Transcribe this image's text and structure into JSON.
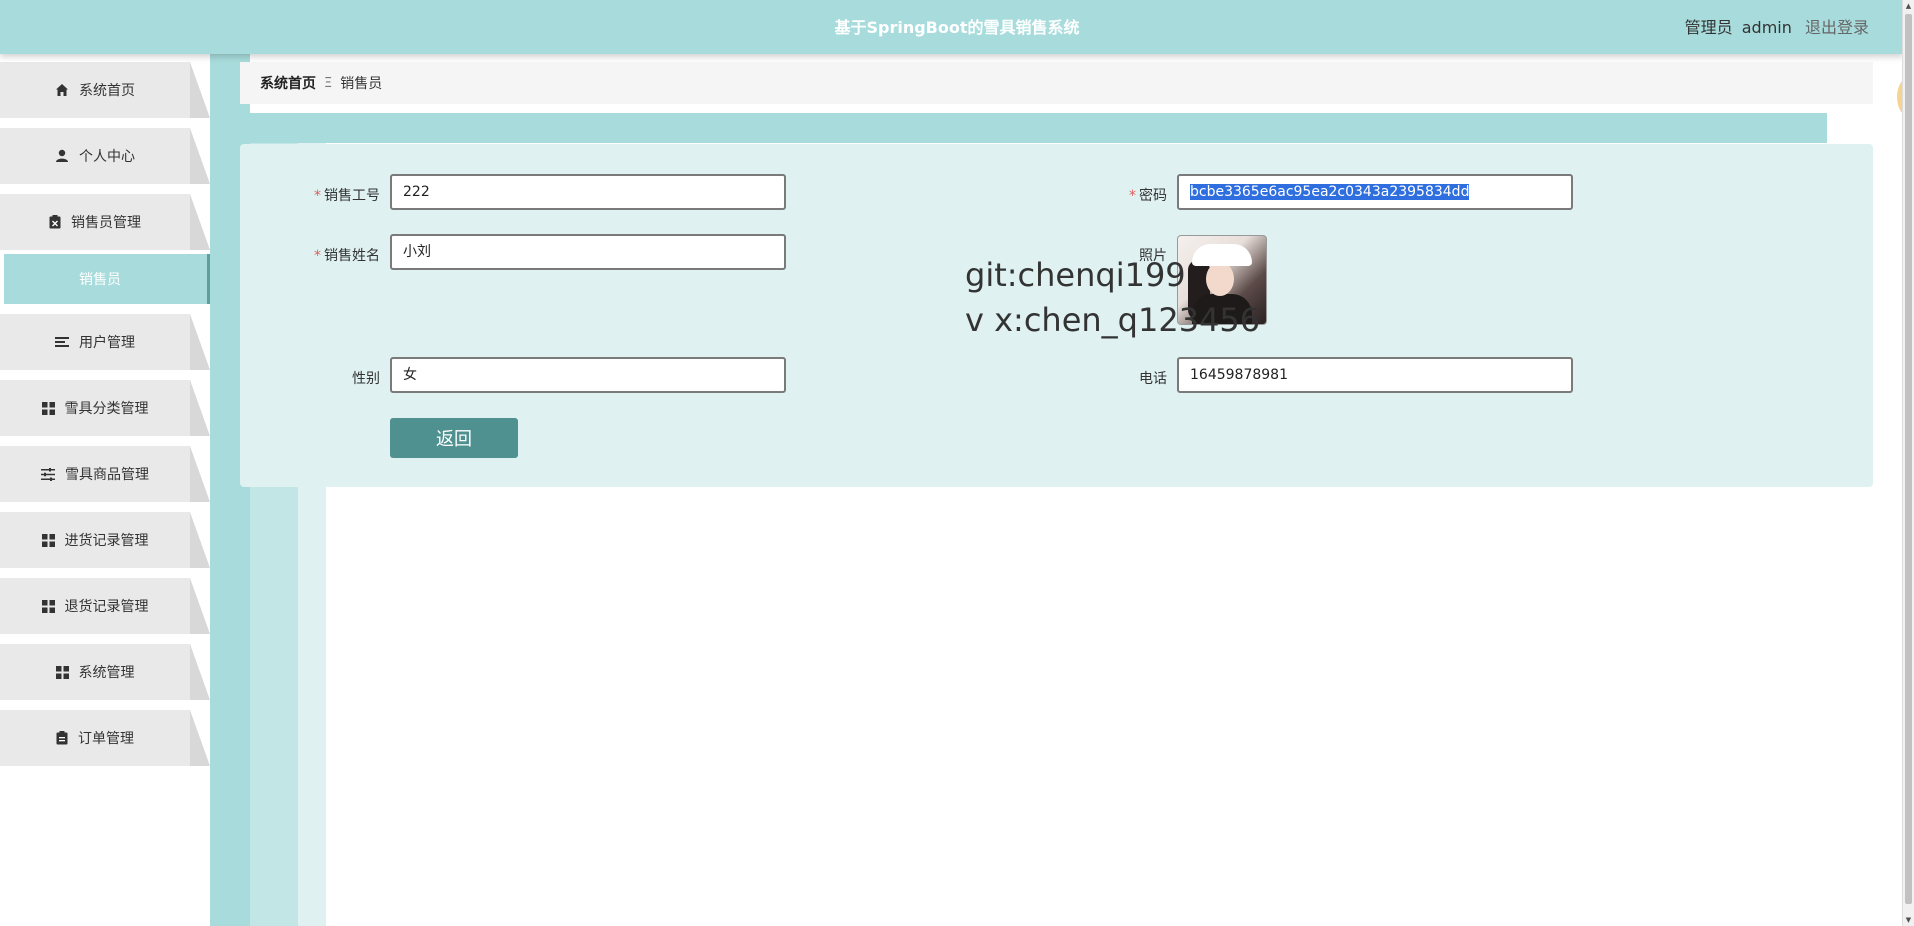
{
  "header": {
    "app_title": "基于SpringBoot的雪具销售系统",
    "user_role": "管理员",
    "user_name": "admin",
    "logout_label": "退出登录"
  },
  "sidebar": {
    "items": [
      {
        "label": "系统首页",
        "icon": "home-icon"
      },
      {
        "label": "个人中心",
        "icon": "user-icon"
      },
      {
        "label": "销售员管理",
        "icon": "clipboard-x-icon"
      },
      {
        "label": "用户管理",
        "icon": "list-icon"
      },
      {
        "label": "雪具分类管理",
        "icon": "grid-icon"
      },
      {
        "label": "雪具商品管理",
        "icon": "sliders-icon"
      },
      {
        "label": "进货记录管理",
        "icon": "grid-icon"
      },
      {
        "label": "退货记录管理",
        "icon": "grid-icon"
      },
      {
        "label": "系统管理",
        "icon": "grid-icon"
      },
      {
        "label": "订单管理",
        "icon": "clipboard-icon"
      }
    ],
    "active_sub": "销售员"
  },
  "breadcrumb": {
    "home": "系统首页",
    "separator": "Ξ",
    "current": "销售员"
  },
  "form": {
    "sales_id_label": "销售工号",
    "sales_id_value": "222",
    "password_label": "密码",
    "password_value": "bcbe3365e6ac95ea2c0343a2395834dd",
    "sales_name_label": "销售姓名",
    "sales_name_value": "小刘",
    "photo_label": "照片",
    "gender_label": "性别",
    "gender_value": "女",
    "phone_label": "电话",
    "phone_value": "16459878981",
    "back_label": "返回",
    "required_mark": "*"
  },
  "watermark": {
    "line1": "git:chenqi199",
    "line2": "v x:chen_q123456"
  },
  "colors": {
    "header_bg": "#a8dcdc",
    "panel_bg": "#dff1f1",
    "button_bg": "#4f9191",
    "active_menu_bg": "#a8dcdc"
  }
}
